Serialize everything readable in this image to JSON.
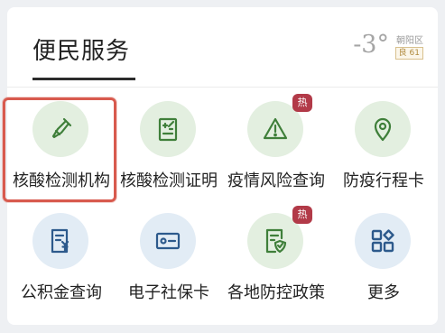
{
  "card": {
    "title": "便民服务"
  },
  "weather": {
    "temperature": "-3°",
    "district": "朝阳区",
    "air_quality": "良 61"
  },
  "services": [
    {
      "label": "核酸检测机构",
      "icon": "pipette-icon",
      "hot": ""
    },
    {
      "label": "核酸检测证明",
      "icon": "certificate-icon",
      "hot": ""
    },
    {
      "label": "疫情风险查询",
      "icon": "warning-icon",
      "hot": "热"
    },
    {
      "label": "防疫行程卡",
      "icon": "location-pin-icon",
      "hot": ""
    },
    {
      "label": "公积金查询",
      "icon": "fund-receipt-icon",
      "hot": ""
    },
    {
      "label": "电子社保卡",
      "icon": "id-card-icon",
      "hot": ""
    },
    {
      "label": "各地防控政策",
      "icon": "policy-shield-icon",
      "hot": "热"
    },
    {
      "label": "更多",
      "icon": "grid-more-icon",
      "hot": ""
    }
  ],
  "colors": {
    "green_icon": "#3f7f3a",
    "blue_icon": "#2d5a8c",
    "hot_badge": "#b23a48",
    "highlight": "#d85a4e"
  }
}
